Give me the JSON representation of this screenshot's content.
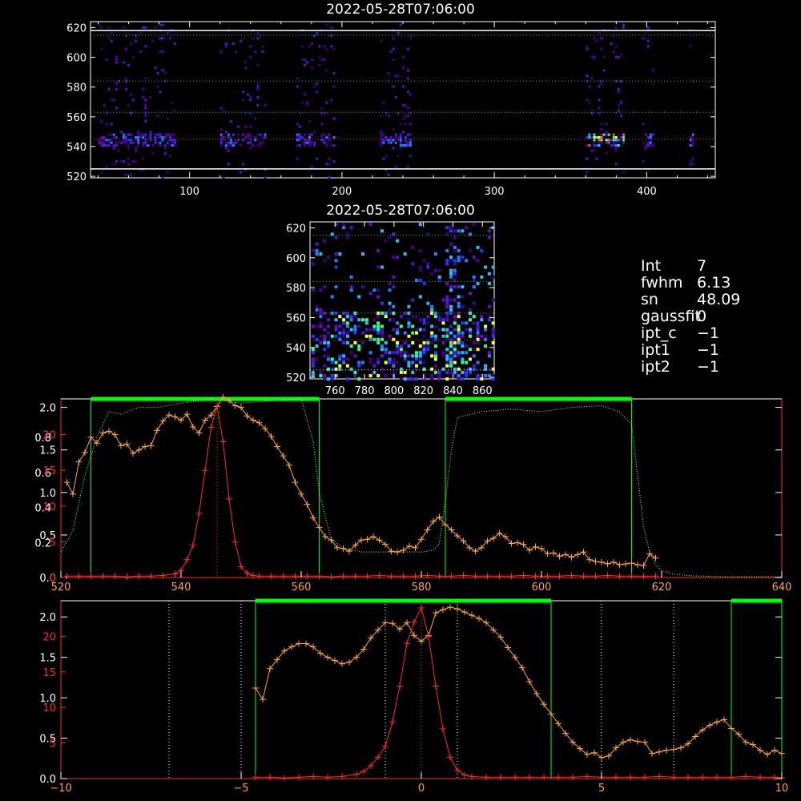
{
  "top_title": "2022-05-28T07:06:00",
  "mid_title": "2022-05-28T07:06:00",
  "info": {
    "rows": [
      {
        "key": "Int",
        "value": "7"
      },
      {
        "key": "fwhm",
        "value": "6.13"
      },
      {
        "key": "sn",
        "value": "48.09"
      },
      {
        "key": "gaussfit",
        "value": "0"
      },
      {
        "key": "ipt_c",
        "value": "−1"
      },
      {
        "key": "ipt1",
        "value": "−1"
      },
      {
        "key": "ipt2",
        "value": "−1"
      }
    ]
  },
  "colors": {
    "axis": "#ffffff",
    "orange": "#ffa63a",
    "red": "#ff2a2a",
    "green": "#00ff00",
    "green_dotted": "#a8ff7a",
    "blue_stripe": "#c8c8ff"
  },
  "chart_data": [
    {
      "type": "heatmap",
      "title": "2022-05-28T07:06:00",
      "xlim": [
        35,
        445
      ],
      "ylim": [
        519,
        624
      ],
      "x_ticks": [
        "100",
        "200",
        "300",
        "400"
      ],
      "y_ticks": [
        "520",
        "540",
        "560",
        "580",
        "600",
        "620"
      ],
      "emission_columns": [
        [
          40,
          90
        ],
        [
          120,
          150
        ],
        [
          170,
          195
        ],
        [
          225,
          245
        ],
        [
          360,
          385
        ],
        [
          397,
          405
        ],
        [
          428,
          431
        ]
      ],
      "line_center_y": 545,
      "guide_lines_y": [
        525,
        545,
        563,
        584,
        615,
        618
      ]
    },
    {
      "type": "heatmap",
      "title": "2022-05-28T07:06:00",
      "xlim": [
        743,
        868
      ],
      "ylim": [
        519,
        624
      ],
      "x_ticks": [
        "760",
        "780",
        "800",
        "820",
        "840",
        "860"
      ],
      "y_ticks": [
        "520",
        "540",
        "560",
        "580",
        "600",
        "620"
      ],
      "guide_lines_y": [
        525,
        545,
        563,
        584,
        615
      ]
    },
    {
      "type": "line",
      "xlim": [
        520,
        640
      ],
      "x_ticks": [
        "520",
        "540",
        "560",
        "580",
        "600",
        "620",
        "640"
      ],
      "y_ticks_left_white": [
        "0.0",
        "0.5",
        "1.0",
        "1.5",
        "2.0"
      ],
      "y_ticks_left_white2": [
        "0.2",
        "0.4",
        "0.6",
        "0.8"
      ],
      "y_ticks_left_red": [
        "0",
        "5",
        "10",
        "15",
        "20"
      ],
      "green_windows": [
        [
          525,
          563
        ],
        [
          584,
          615
        ]
      ],
      "center_line_x": 546,
      "series": [
        {
          "color": "orange",
          "x": [
            521,
            522,
            523,
            524,
            525,
            526,
            527,
            528,
            529,
            530,
            531,
            532,
            533,
            534,
            535,
            536,
            537,
            538,
            539,
            540,
            541,
            542,
            543,
            544,
            545,
            546,
            547,
            548,
            549,
            550,
            551,
            552,
            553,
            554,
            555,
            556,
            557,
            558,
            559,
            560,
            561,
            562,
            563,
            564,
            565,
            566,
            567,
            568,
            569,
            570,
            571,
            572,
            573,
            574,
            575,
            576,
            577,
            578,
            579,
            580,
            581,
            582,
            583,
            584,
            585,
            586,
            587,
            588,
            589,
            590,
            591,
            592,
            593,
            594,
            595,
            596,
            597,
            598,
            599,
            600,
            601,
            602,
            603,
            604,
            605,
            606,
            607,
            608,
            609,
            610,
            611,
            612,
            613,
            614,
            615,
            616,
            617,
            618,
            619
          ],
          "y": [
            1.12,
            0.98,
            1.36,
            1.47,
            1.65,
            1.58,
            1.7,
            1.72,
            1.68,
            1.55,
            1.57,
            1.46,
            1.5,
            1.54,
            1.55,
            1.73,
            1.84,
            1.91,
            1.89,
            1.85,
            1.92,
            1.77,
            1.7,
            1.85,
            1.91,
            2.01,
            2.12,
            2.08,
            2.02,
            2.0,
            1.9,
            1.85,
            1.82,
            1.75,
            1.66,
            1.54,
            1.43,
            1.32,
            1.12,
            0.98,
            0.86,
            0.7,
            0.59,
            0.48,
            0.44,
            0.35,
            0.34,
            0.31,
            0.38,
            0.44,
            0.45,
            0.48,
            0.44,
            0.39,
            0.31,
            0.3,
            0.32,
            0.37,
            0.35,
            0.45,
            0.56,
            0.66,
            0.71,
            0.62,
            0.56,
            0.49,
            0.43,
            0.35,
            0.31,
            0.35,
            0.43,
            0.46,
            0.52,
            0.48,
            0.4,
            0.41,
            0.39,
            0.32,
            0.36,
            0.34,
            0.28,
            0.29,
            0.25,
            0.27,
            0.24,
            0.27,
            0.3,
            0.21,
            0.19,
            0.18,
            0.16,
            0.18,
            0.15,
            0.16,
            0.17,
            0.15,
            0.14,
            0.28,
            0.23
          ]
        },
        {
          "color": "red",
          "x": [
            521,
            523,
            525,
            527,
            529,
            531,
            533,
            535,
            537,
            539,
            540,
            541,
            542,
            543,
            544,
            545,
            546,
            547,
            548,
            549,
            550,
            551,
            552,
            553,
            555,
            557,
            559,
            561,
            563,
            565,
            567,
            569,
            571,
            573,
            575,
            577,
            579,
            581,
            583,
            585,
            587,
            589,
            591,
            593,
            595,
            597,
            599,
            601,
            603,
            605,
            607,
            609,
            611,
            613,
            615,
            617,
            619
          ],
          "y": [
            0.2,
            0.2,
            0.2,
            0.2,
            0.2,
            0.1,
            0.2,
            0.2,
            0.3,
            0.5,
            1.0,
            2.5,
            4.5,
            9.0,
            15.0,
            21.0,
            24.0,
            19.0,
            11.0,
            5.0,
            1.5,
            0.6,
            0.3,
            0.2,
            0.2,
            0.2,
            0.2,
            0.2,
            0.2,
            0.1,
            0.2,
            0.2,
            0.2,
            0.3,
            0.2,
            0.2,
            0.2,
            0.3,
            0.2,
            0.2,
            0.3,
            0.2,
            0.2,
            0.2,
            0.2,
            0.3,
            0.2,
            0.2,
            0.2,
            0.3,
            0.2,
            0.2,
            0.3,
            0.2,
            0.2,
            0.2,
            0.2
          ]
        },
        {
          "color": "green_dotted",
          "x": [
            520,
            522,
            524,
            526,
            528,
            530,
            533,
            536,
            540,
            545,
            550,
            555,
            560,
            562,
            563,
            565,
            567,
            570,
            575,
            580,
            582,
            583,
            584,
            585,
            586,
            590,
            595,
            600,
            605,
            610,
            613,
            615,
            616,
            617,
            618,
            619,
            620,
            622,
            625,
            630,
            635,
            640
          ],
          "y": [
            0.3,
            0.55,
            1.2,
            1.65,
            1.95,
            1.92,
            2.0,
            2.0,
            2.05,
            2.1,
            2.05,
            2.08,
            2.1,
            1.6,
            1.0,
            0.45,
            0.35,
            0.3,
            0.3,
            0.3,
            0.32,
            0.4,
            0.9,
            1.5,
            1.88,
            1.95,
            1.98,
            1.95,
            2.0,
            2.02,
            1.95,
            1.8,
            1.2,
            0.6,
            0.3,
            0.15,
            0.08,
            0.04,
            0.02,
            0.01,
            0.01,
            0.01
          ]
        }
      ]
    },
    {
      "type": "line",
      "xlim": [
        -10,
        10
      ],
      "x_ticks": [
        "−10",
        "−5",
        "0",
        "5",
        "10"
      ],
      "y_ticks_left_white": [
        "0.0",
        "0.5",
        "1.0",
        "1.5",
        "2.0"
      ],
      "y_ticks_left_red": [
        "5",
        "10",
        "15",
        "20"
      ],
      "green_windows": [
        [
          -4.6,
          3.6
        ],
        [
          8.6,
          10
        ]
      ],
      "dotted_white_x": [
        -7,
        -5,
        -1,
        1,
        5,
        7
      ],
      "center_line_x": 0,
      "series": [
        {
          "color": "orange",
          "x": [
            -4.6,
            -4.4,
            -4.2,
            -4.0,
            -3.8,
            -3.6,
            -3.4,
            -3.2,
            -3.0,
            -2.8,
            -2.6,
            -2.4,
            -2.2,
            -2.0,
            -1.8,
            -1.6,
            -1.4,
            -1.2,
            -1.0,
            -0.8,
            -0.6,
            -0.4,
            -0.2,
            0.0,
            0.2,
            0.4,
            0.6,
            0.8,
            1.0,
            1.2,
            1.4,
            1.6,
            1.8,
            2.0,
            2.2,
            2.4,
            2.6,
            2.8,
            3.0,
            3.2,
            3.4,
            3.6,
            3.8,
            4.0,
            4.2,
            4.4,
            4.6,
            4.8,
            5.0,
            5.2,
            5.4,
            5.6,
            5.8,
            6.0,
            6.2,
            6.4,
            6.6,
            6.8,
            7.0,
            7.2,
            7.4,
            7.6,
            7.8,
            8.0,
            8.2,
            8.4,
            8.6,
            8.8,
            9.0,
            9.2,
            9.4,
            9.6,
            9.8,
            10.0
          ],
          "y": [
            1.12,
            0.98,
            1.36,
            1.47,
            1.58,
            1.63,
            1.67,
            1.67,
            1.63,
            1.55,
            1.5,
            1.46,
            1.42,
            1.44,
            1.5,
            1.6,
            1.74,
            1.84,
            1.93,
            1.92,
            1.85,
            1.93,
            1.77,
            1.7,
            1.77,
            2.05,
            2.09,
            2.12,
            2.1,
            2.06,
            2.02,
            1.98,
            1.93,
            1.84,
            1.75,
            1.62,
            1.5,
            1.37,
            1.2,
            1.05,
            0.92,
            0.8,
            0.68,
            0.56,
            0.45,
            0.37,
            0.3,
            0.32,
            0.26,
            0.28,
            0.38,
            0.45,
            0.48,
            0.46,
            0.45,
            0.31,
            0.33,
            0.35,
            0.36,
            0.38,
            0.43,
            0.52,
            0.6,
            0.66,
            0.7,
            0.73,
            0.62,
            0.55,
            0.45,
            0.42,
            0.35,
            0.3,
            0.35,
            0.31
          ]
        },
        {
          "color": "red",
          "x": [
            -4.6,
            -4.2,
            -3.8,
            -3.4,
            -3.0,
            -2.6,
            -2.2,
            -1.8,
            -1.6,
            -1.4,
            -1.2,
            -1.0,
            -0.8,
            -0.6,
            -0.4,
            -0.2,
            0.0,
            0.2,
            0.4,
            0.6,
            0.8,
            1.0,
            1.2,
            1.4,
            1.8,
            2.2,
            2.6,
            3.0,
            3.4,
            3.8,
            4.2,
            4.6,
            5.0,
            5.4,
            5.8,
            6.2,
            6.6,
            7.0,
            7.4,
            7.8,
            8.2,
            8.6,
            9.0,
            9.4,
            9.8,
            10.0
          ],
          "y": [
            0.2,
            0.2,
            0.1,
            0.2,
            0.3,
            0.2,
            0.3,
            0.6,
            1.0,
            1.8,
            3.0,
            4.5,
            8.0,
            13.0,
            19.0,
            22.0,
            24.0,
            20.0,
            13.0,
            7.0,
            3.0,
            1.2,
            0.5,
            0.3,
            0.2,
            0.2,
            0.2,
            0.2,
            0.2,
            0.2,
            0.2,
            0.3,
            0.2,
            0.2,
            0.2,
            0.2,
            0.3,
            0.2,
            0.2,
            0.2,
            0.2,
            0.2,
            0.3,
            0.2,
            0.2,
            0.1
          ]
        }
      ]
    }
  ]
}
